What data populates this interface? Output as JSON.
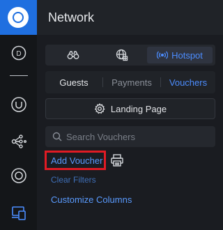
{
  "sidebar": {
    "items": [
      {
        "icon": "logo-icon"
      },
      {
        "icon": "dashboard-d-icon",
        "letter": "D"
      },
      {
        "icon": "divider"
      },
      {
        "icon": "ubiquiti-u-icon"
      },
      {
        "icon": "topology-icon"
      },
      {
        "icon": "devices-target-icon"
      },
      {
        "icon": "client-devices-icon",
        "active": true
      }
    ]
  },
  "header": {
    "title": "Network"
  },
  "segmented": {
    "items": [
      {
        "icon": "binoculars-icon",
        "label": ""
      },
      {
        "icon": "globe-grid-icon",
        "label": ""
      },
      {
        "icon": "hotspot-broadcast-icon",
        "label": "Hotspot",
        "active": true
      }
    ]
  },
  "tabs": [
    {
      "label": "Guests"
    },
    {
      "label": "Payments"
    },
    {
      "label": "Vouchers",
      "active": true
    }
  ],
  "landing_page": {
    "label": "Landing Page"
  },
  "search": {
    "placeholder": "Search Vouchers"
  },
  "actions": {
    "add_voucher": "Add Voucher",
    "clear_filters": "Clear Filters",
    "customize_columns": "Customize Columns"
  },
  "colors": {
    "accent": "#4c8dff",
    "highlight": "#e01b24",
    "brand": "#1f6fe0"
  }
}
